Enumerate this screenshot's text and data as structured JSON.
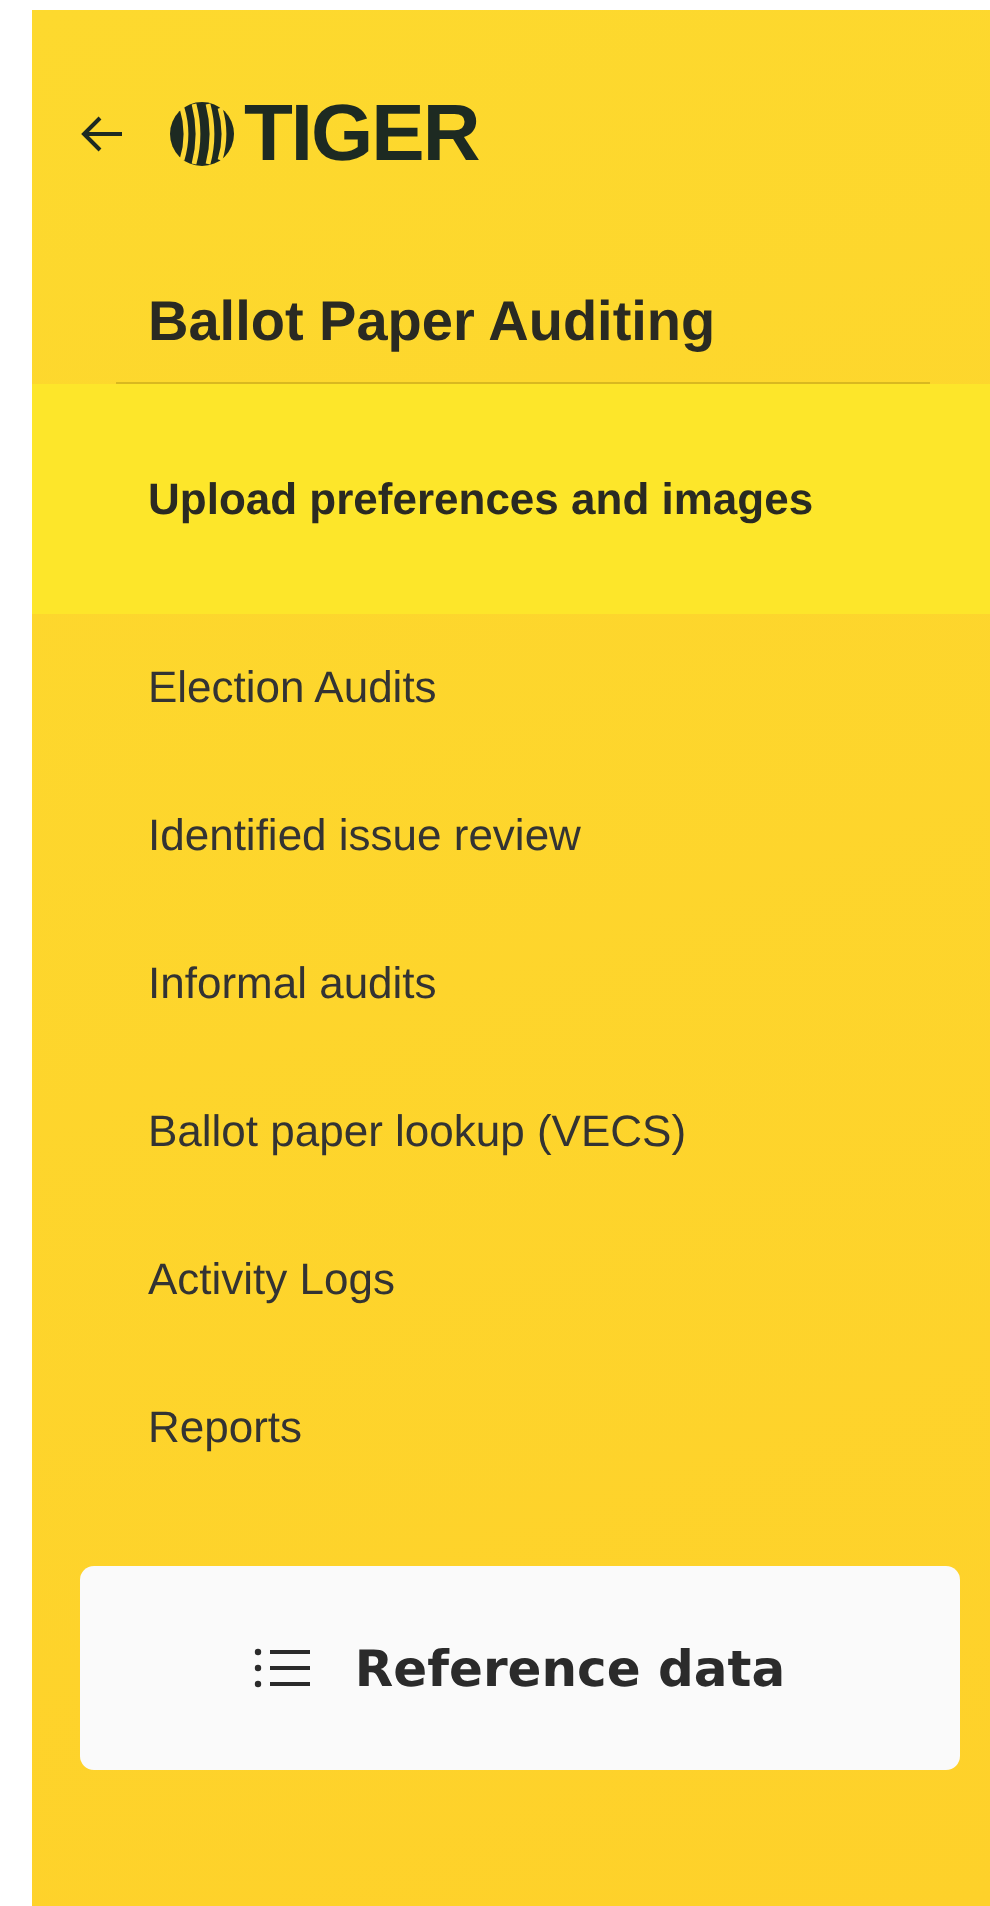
{
  "header": {
    "logo_text": "TIGER"
  },
  "section": {
    "title": "Ballot Paper Auditing"
  },
  "menu": [
    {
      "label": "Upload preferences and images",
      "selected": true
    },
    {
      "label": "Election Audits",
      "selected": false
    },
    {
      "label": "Identified issue review",
      "selected": false
    },
    {
      "label": "Informal audits",
      "selected": false
    },
    {
      "label": "Ballot paper lookup (VECS)",
      "selected": false
    },
    {
      "label": "Activity Logs",
      "selected": false
    },
    {
      "label": "Reports",
      "selected": false
    }
  ],
  "reference_button": {
    "label": "Reference data"
  }
}
